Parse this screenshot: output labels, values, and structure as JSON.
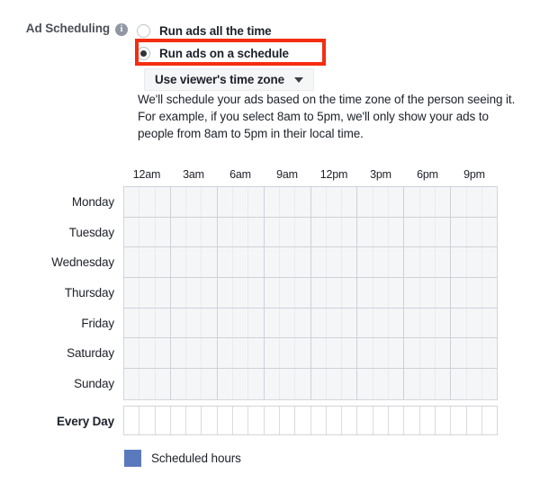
{
  "section": {
    "label": "Ad Scheduling",
    "info_icon": "info-icon",
    "info_glyph": "i"
  },
  "options": [
    {
      "label": "Run ads all the time",
      "selected": false
    },
    {
      "label": "Run ads on a schedule",
      "selected": true
    }
  ],
  "highlight": {
    "color": "#f52d10",
    "target": "Run ads on a schedule"
  },
  "timezone_dropdown": {
    "value": "Use viewer's time zone",
    "caret_icon": "chevron-down-icon"
  },
  "description": {
    "line1": "We'll schedule your ads based on the time zone of the person seeing it.",
    "line2": "For example, if you select 8am to 5pm, we'll only show your ads to people from 8am to 5pm in their local time."
  },
  "schedule": {
    "time_ticks": [
      "12am",
      "3am",
      "6am",
      "9am",
      "12pm",
      "3pm",
      "6pm",
      "9pm"
    ],
    "hours_per_tick": 3,
    "total_hours": 24,
    "days": [
      "Monday",
      "Tuesday",
      "Wednesday",
      "Thursday",
      "Friday",
      "Saturday",
      "Sunday"
    ],
    "every_day_label": "Every Day",
    "scheduled_cells": []
  },
  "legend": {
    "swatch_color": "#5b79bd",
    "label": "Scheduled hours"
  }
}
